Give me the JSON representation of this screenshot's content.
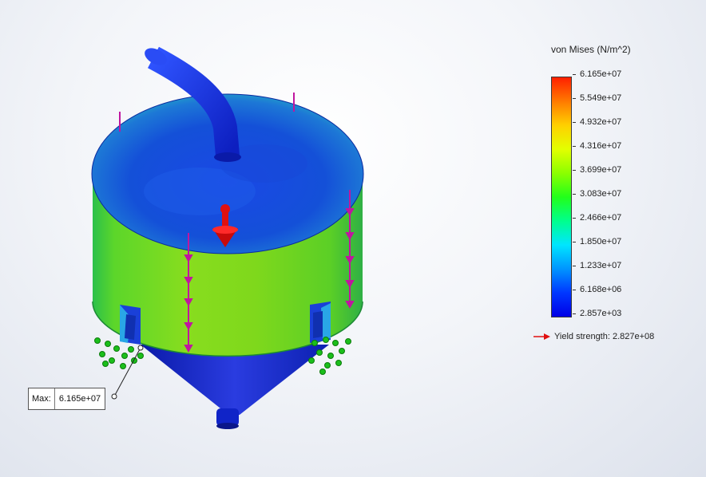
{
  "legend": {
    "title": "von Mises (N/m^2)",
    "ticks": [
      "6.165e+07",
      "5.549e+07",
      "4.932e+07",
      "4.316e+07",
      "3.699e+07",
      "3.083e+07",
      "2.466e+07",
      "1.850e+07",
      "1.233e+07",
      "6.168e+06",
      "2.857e+03"
    ],
    "yield_strength": "Yield strength: 2.827e+08"
  },
  "probe": {
    "label": "Max:",
    "value": "6.165e+07"
  },
  "colors": {
    "arrow_red": "#e01010",
    "load_magenta": "#c0169f",
    "fixture_green": "#1bbf1b"
  }
}
